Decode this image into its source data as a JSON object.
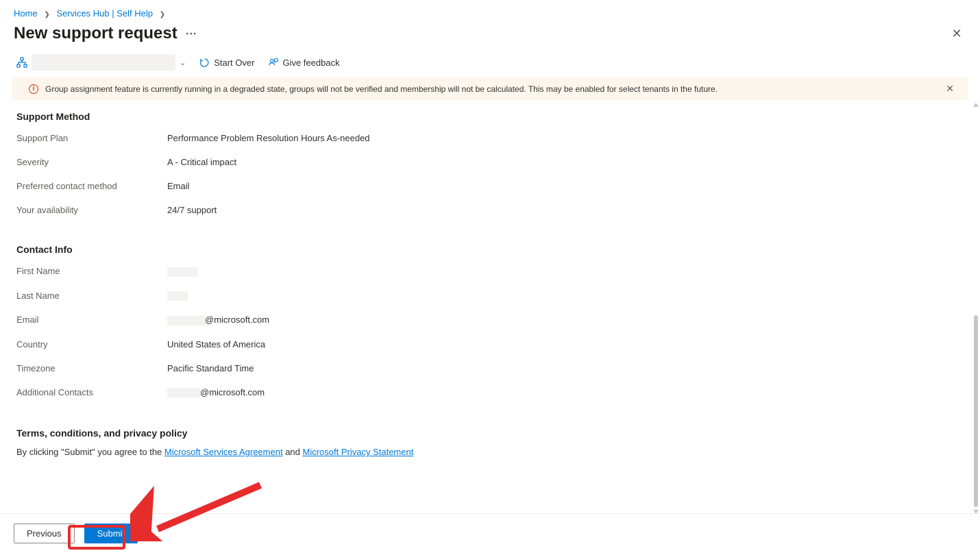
{
  "breadcrumb": {
    "home": "Home",
    "services": "Services Hub | Self Help"
  },
  "page_title": "New support request",
  "toolbar": {
    "start_over": "Start Over",
    "give_feedback": "Give feedback"
  },
  "alert": {
    "text": "Group assignment feature is currently running in a degraded state, groups will not be verified and membership will not be calculated. This may be enabled for select tenants in the future."
  },
  "support_method": {
    "title": "Support Method",
    "rows": [
      {
        "label": "Support Plan",
        "value": "Performance Problem Resolution Hours As-needed"
      },
      {
        "label": "Severity",
        "value": "A - Critical impact"
      },
      {
        "label": "Preferred contact method",
        "value": "Email"
      },
      {
        "label": "Your availability",
        "value": "24/7 support"
      }
    ]
  },
  "contact_info": {
    "title": "Contact Info",
    "rows": [
      {
        "label": "First Name"
      },
      {
        "label": "Last Name"
      },
      {
        "label": "Email",
        "suffix": "@microsoft.com"
      },
      {
        "label": "Country",
        "value": "United States of America"
      },
      {
        "label": "Timezone",
        "value": "Pacific Standard Time"
      },
      {
        "label": "Additional Contacts",
        "suffix": "@microsoft.com"
      }
    ]
  },
  "terms": {
    "title": "Terms, conditions, and privacy policy",
    "prefix": "By clicking \"Submit\" you agree to the ",
    "link1": "Microsoft Services Agreement",
    "middle": " and ",
    "link2": "Microsoft Privacy Statement"
  },
  "footer": {
    "previous": "Previous",
    "submit": "Submit"
  }
}
